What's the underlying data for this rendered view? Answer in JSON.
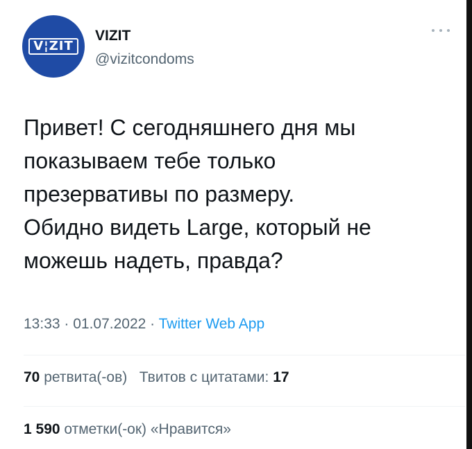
{
  "author": {
    "logo_text": "V¦ZIT",
    "display_name": "VIZIT",
    "handle": "@vizitcondoms"
  },
  "tweet": {
    "text": "Привет! С сегодняшнего дня мы\nпоказываем тебе только\nпрезервативы по размеру.\nОбидно видеть Large, который не\nможешь надеть, правда?",
    "time": "13:33",
    "date": "01.07.2022",
    "separator": " · ",
    "source": "Twitter Web App"
  },
  "stats": {
    "retweets_count": "70",
    "retweets_label": "ретвита(-ов)",
    "quotes_label": "Твитов с цитатами:",
    "quotes_count": "17",
    "likes_count": "1 590",
    "likes_label": "отметки(-ок) «Нравится»"
  },
  "colors": {
    "avatar_bg": "#1f4ba5",
    "link": "#1d9bf0",
    "secondary_text": "#536471"
  },
  "icons": {
    "more": "more-horizontal-icon"
  }
}
